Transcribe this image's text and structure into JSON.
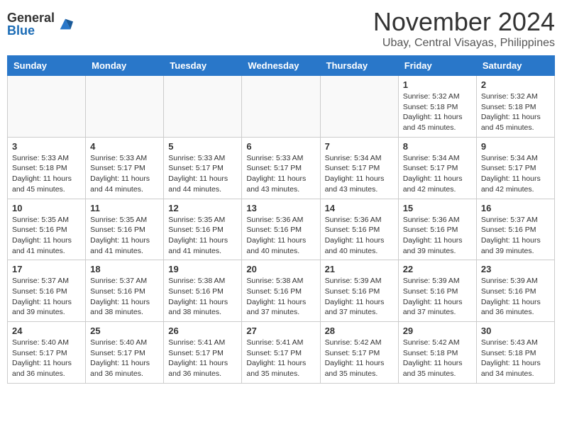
{
  "header": {
    "logo_general": "General",
    "logo_blue": "Blue",
    "month_title": "November 2024",
    "subtitle": "Ubay, Central Visayas, Philippines"
  },
  "weekdays": [
    "Sunday",
    "Monday",
    "Tuesday",
    "Wednesday",
    "Thursday",
    "Friday",
    "Saturday"
  ],
  "weeks": [
    [
      {
        "day": "",
        "info": ""
      },
      {
        "day": "",
        "info": ""
      },
      {
        "day": "",
        "info": ""
      },
      {
        "day": "",
        "info": ""
      },
      {
        "day": "",
        "info": ""
      },
      {
        "day": "1",
        "info": "Sunrise: 5:32 AM\nSunset: 5:18 PM\nDaylight: 11 hours and 45 minutes."
      },
      {
        "day": "2",
        "info": "Sunrise: 5:32 AM\nSunset: 5:18 PM\nDaylight: 11 hours and 45 minutes."
      }
    ],
    [
      {
        "day": "3",
        "info": "Sunrise: 5:33 AM\nSunset: 5:18 PM\nDaylight: 11 hours and 45 minutes."
      },
      {
        "day": "4",
        "info": "Sunrise: 5:33 AM\nSunset: 5:17 PM\nDaylight: 11 hours and 44 minutes."
      },
      {
        "day": "5",
        "info": "Sunrise: 5:33 AM\nSunset: 5:17 PM\nDaylight: 11 hours and 44 minutes."
      },
      {
        "day": "6",
        "info": "Sunrise: 5:33 AM\nSunset: 5:17 PM\nDaylight: 11 hours and 43 minutes."
      },
      {
        "day": "7",
        "info": "Sunrise: 5:34 AM\nSunset: 5:17 PM\nDaylight: 11 hours and 43 minutes."
      },
      {
        "day": "8",
        "info": "Sunrise: 5:34 AM\nSunset: 5:17 PM\nDaylight: 11 hours and 42 minutes."
      },
      {
        "day": "9",
        "info": "Sunrise: 5:34 AM\nSunset: 5:17 PM\nDaylight: 11 hours and 42 minutes."
      }
    ],
    [
      {
        "day": "10",
        "info": "Sunrise: 5:35 AM\nSunset: 5:16 PM\nDaylight: 11 hours and 41 minutes."
      },
      {
        "day": "11",
        "info": "Sunrise: 5:35 AM\nSunset: 5:16 PM\nDaylight: 11 hours and 41 minutes."
      },
      {
        "day": "12",
        "info": "Sunrise: 5:35 AM\nSunset: 5:16 PM\nDaylight: 11 hours and 41 minutes."
      },
      {
        "day": "13",
        "info": "Sunrise: 5:36 AM\nSunset: 5:16 PM\nDaylight: 11 hours and 40 minutes."
      },
      {
        "day": "14",
        "info": "Sunrise: 5:36 AM\nSunset: 5:16 PM\nDaylight: 11 hours and 40 minutes."
      },
      {
        "day": "15",
        "info": "Sunrise: 5:36 AM\nSunset: 5:16 PM\nDaylight: 11 hours and 39 minutes."
      },
      {
        "day": "16",
        "info": "Sunrise: 5:37 AM\nSunset: 5:16 PM\nDaylight: 11 hours and 39 minutes."
      }
    ],
    [
      {
        "day": "17",
        "info": "Sunrise: 5:37 AM\nSunset: 5:16 PM\nDaylight: 11 hours and 39 minutes."
      },
      {
        "day": "18",
        "info": "Sunrise: 5:37 AM\nSunset: 5:16 PM\nDaylight: 11 hours and 38 minutes."
      },
      {
        "day": "19",
        "info": "Sunrise: 5:38 AM\nSunset: 5:16 PM\nDaylight: 11 hours and 38 minutes."
      },
      {
        "day": "20",
        "info": "Sunrise: 5:38 AM\nSunset: 5:16 PM\nDaylight: 11 hours and 37 minutes."
      },
      {
        "day": "21",
        "info": "Sunrise: 5:39 AM\nSunset: 5:16 PM\nDaylight: 11 hours and 37 minutes."
      },
      {
        "day": "22",
        "info": "Sunrise: 5:39 AM\nSunset: 5:16 PM\nDaylight: 11 hours and 37 minutes."
      },
      {
        "day": "23",
        "info": "Sunrise: 5:39 AM\nSunset: 5:16 PM\nDaylight: 11 hours and 36 minutes."
      }
    ],
    [
      {
        "day": "24",
        "info": "Sunrise: 5:40 AM\nSunset: 5:17 PM\nDaylight: 11 hours and 36 minutes."
      },
      {
        "day": "25",
        "info": "Sunrise: 5:40 AM\nSunset: 5:17 PM\nDaylight: 11 hours and 36 minutes."
      },
      {
        "day": "26",
        "info": "Sunrise: 5:41 AM\nSunset: 5:17 PM\nDaylight: 11 hours and 36 minutes."
      },
      {
        "day": "27",
        "info": "Sunrise: 5:41 AM\nSunset: 5:17 PM\nDaylight: 11 hours and 35 minutes."
      },
      {
        "day": "28",
        "info": "Sunrise: 5:42 AM\nSunset: 5:17 PM\nDaylight: 11 hours and 35 minutes."
      },
      {
        "day": "29",
        "info": "Sunrise: 5:42 AM\nSunset: 5:18 PM\nDaylight: 11 hours and 35 minutes."
      },
      {
        "day": "30",
        "info": "Sunrise: 5:43 AM\nSunset: 5:18 PM\nDaylight: 11 hours and 34 minutes."
      }
    ]
  ]
}
